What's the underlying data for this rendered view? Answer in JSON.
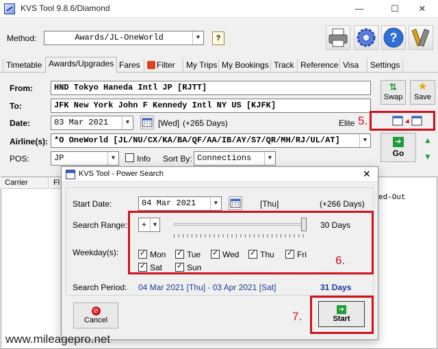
{
  "window": {
    "title": "KVS Tool 9.8.6/Diamond",
    "minimize": "—",
    "maximize": "☐",
    "close": "✕"
  },
  "method": {
    "label": "Method:",
    "value": "Awards/JL-OneWorld"
  },
  "tabs": [
    "Timetable",
    "Awards/Upgrades",
    "Fares",
    "Filter",
    "My Trips",
    "My Bookings",
    "Track",
    "Reference",
    "Visa",
    "Settings"
  ],
  "form": {
    "from_label": "From:",
    "from_value": "HND  Tokyo Haneda Intl JP [RJTT]",
    "to_label": "To:",
    "to_value": "JFK  New York John F Kennedy Intl NY US [KJFK]",
    "date_label": "Date:",
    "date_value": "03 Mar 2021",
    "date_weekday": "[Wed]",
    "date_offset": "(+265 Days)",
    "elite_label": "Elite",
    "airlines_label": "Airline(s):",
    "airlines_value": "*O  OneWorld [JL/NU/CX/KA/BA/QF/AA/IB/AY/S7/QR/MH/RJ/UL/AT]",
    "pos_label": "POS:",
    "pos_value": "JP",
    "info_label": "Info",
    "sortby_label": "Sort By:",
    "sortby_value": "Connections"
  },
  "buttons": {
    "swap": "Swap",
    "save": "Save",
    "go": "Go"
  },
  "annotations": {
    "step5": "5.",
    "step6": "6.",
    "step7": "7."
  },
  "results": {
    "col_carrier": "Carrier",
    "col_fl": "Fl",
    "col_status": "ed-Out"
  },
  "dialog": {
    "title": "KVS Tool - Power Search",
    "start_date_label": "Start Date:",
    "start_date_value": "04 Mar 2021",
    "start_weekday": "[Thu]",
    "start_offset": "(+266 Days)",
    "search_range_label": "Search Range:",
    "range_sign": "+",
    "range_days": "30 Days",
    "weekdays_label": "Weekday(s):",
    "weekdays": [
      "Mon",
      "Tue",
      "Wed",
      "Thu",
      "Fri",
      "Sat",
      "Sun"
    ],
    "search_period_label": "Search Period:",
    "search_period_value": "04 Mar 2021 [Thu] - 03 Apr 2021 [Sat]",
    "search_period_days": "31 Days",
    "cancel": "Cancel",
    "start": "Start"
  },
  "watermark": "www.mileagepro.net",
  "colors": {
    "accent_red": "#d0101a",
    "link_blue": "#1a3b9a",
    "go_green": "#1f9d3a"
  }
}
